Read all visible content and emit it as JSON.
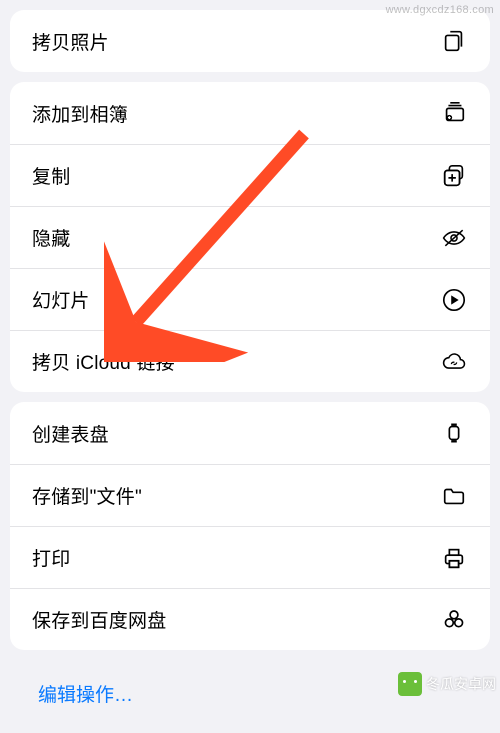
{
  "groups": [
    {
      "rows": [
        {
          "label": "拷贝照片",
          "icon": "copy-photo-icon"
        }
      ]
    },
    {
      "rows": [
        {
          "label": "添加到相簿",
          "icon": "add-to-album-icon"
        },
        {
          "label": "复制",
          "icon": "duplicate-icon"
        },
        {
          "label": "隐藏",
          "icon": "hide-icon"
        },
        {
          "label": "幻灯片",
          "icon": "slideshow-icon"
        },
        {
          "label": "拷贝 iCloud 链接",
          "icon": "icloud-link-icon"
        }
      ]
    },
    {
      "rows": [
        {
          "label": "创建表盘",
          "icon": "watch-face-icon"
        },
        {
          "label": "存储到\"文件\"",
          "icon": "save-to-files-icon"
        },
        {
          "label": "打印",
          "icon": "print-icon"
        },
        {
          "label": "保存到百度网盘",
          "icon": "baidu-pan-icon"
        }
      ]
    }
  ],
  "editActions": "编辑操作…",
  "arrow": {
    "color": "#ff4b26"
  },
  "watermark": {
    "topRight": "www.dgxcdz168.com",
    "bottomRight": "冬瓜安卓网"
  }
}
